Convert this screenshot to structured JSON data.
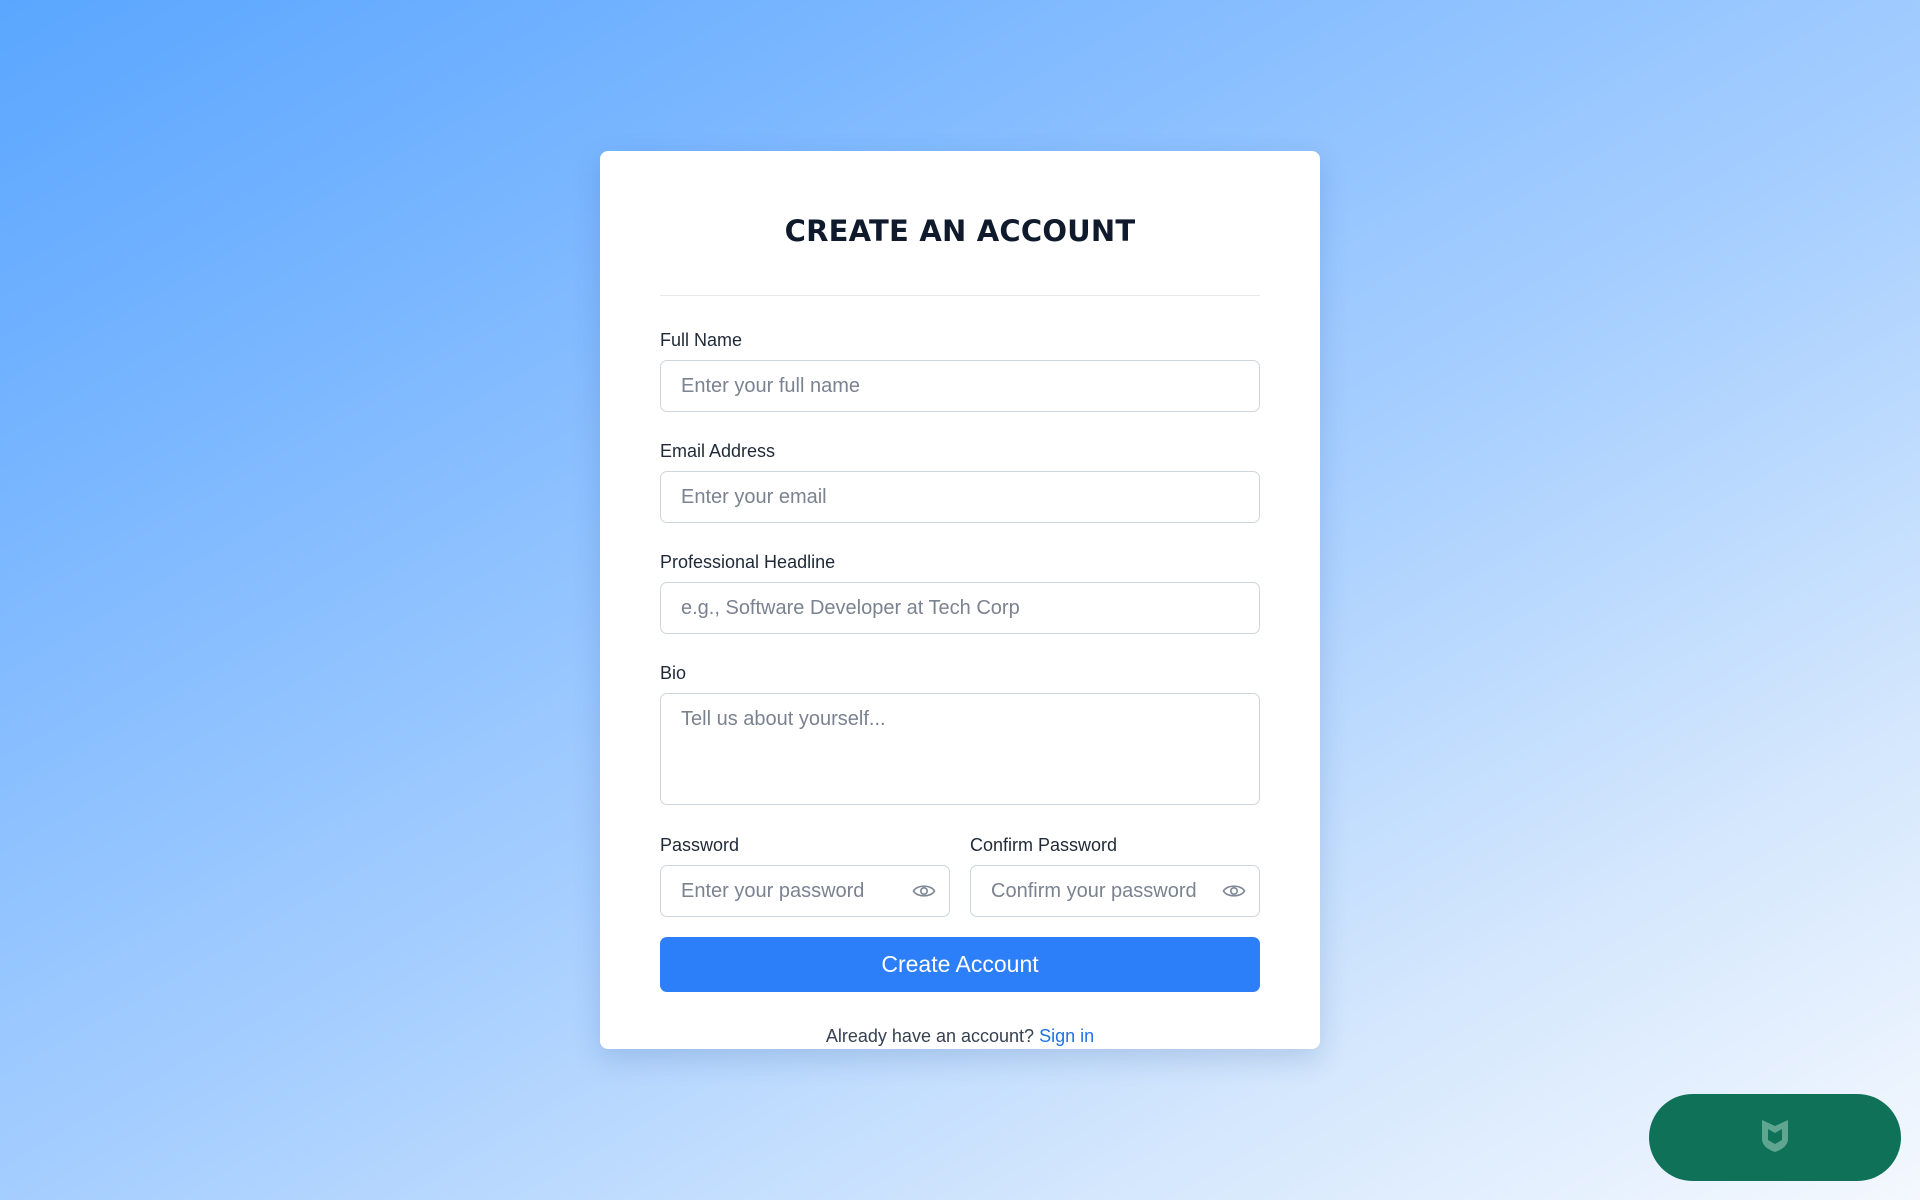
{
  "form": {
    "title": "CREATE AN ACCOUNT",
    "full_name": {
      "label": "Full Name",
      "placeholder": "Enter your full name"
    },
    "email": {
      "label": "Email Address",
      "placeholder": "Enter your email"
    },
    "headline": {
      "label": "Professional Headline",
      "placeholder": "e.g., Software Developer at Tech Corp"
    },
    "bio": {
      "label": "Bio",
      "placeholder": "Tell us about yourself..."
    },
    "password": {
      "label": "Password",
      "placeholder": "Enter your password"
    },
    "confirm_password": {
      "label": "Confirm Password",
      "placeholder": "Confirm your password"
    },
    "submit_label": "Create Account",
    "signin_prompt": "Already have an account?",
    "signin_link": "Sign in"
  },
  "floating_button": {
    "icon": "shield-icon"
  },
  "colors": {
    "primary": "#2d7ff9",
    "link": "#1f73e8",
    "floating_button": "#0f7258"
  }
}
